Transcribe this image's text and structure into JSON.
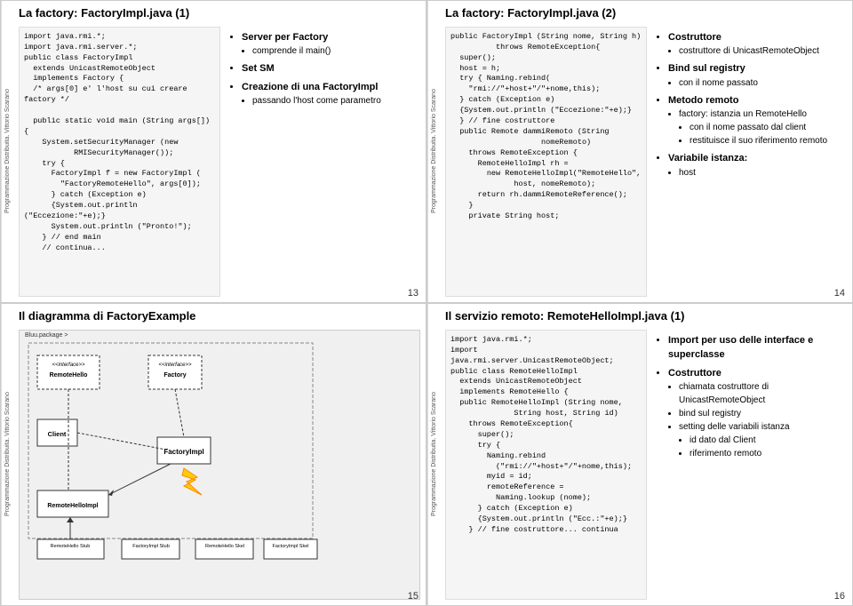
{
  "slides": [
    {
      "id": "slide-13",
      "title": "La factory:  FactoryImpl.java (1)",
      "side_label": "Programmazione Distribuita. Vittorio Scarano",
      "slide_num": "13",
      "code": "import java.rmi.*;\nimport java.rmi.server.*;\npublic class FactoryImpl\n  extends UnicastRemoteObject\n  implements Factory {\n  /* args[0] e' l'host su cui creare factory */\n\n  public static void main (String args[]) {\n    System.setSecurityManager (new\n           RMISecurityManager());\n    try {\n      FactoryImpl f = new FactoryImpl (\n        \"FactoryRemoteHello\", args[0]);\n      } catch (Exception e)\n      {System.out.println (\"Eccezione:\"+e);}\n      System.out.println (\"Pronto!\");\n    } // end main\n    // continua...",
      "bullets": [
        {
          "text": "Server per Factory",
          "level": 0,
          "bold": true
        },
        {
          "text": "comprende il main()",
          "level": 1,
          "bold": false
        },
        {
          "text": "Set SM",
          "level": 0,
          "bold": true
        },
        {
          "text": "Creazione di una FactoryImpl",
          "level": 0,
          "bold": true
        },
        {
          "text": "passando l'host come parametro",
          "level": 1,
          "bold": false
        }
      ]
    },
    {
      "id": "slide-14",
      "title": "La factory:  FactoryImpl.java (2)",
      "side_label": "Programmazione Distribuita. Vittorio Scarano",
      "slide_num": "14",
      "code": "public FactoryImpl (String nome, String h)\n          throws RemoteException{\n  super();\n  host = h;\n  try { Naming.rebind(\n    \"rmi://\"+host+\"/\"+nome,this);\n  } catch (Exception e)\n  {System.out.println (\"Eccezione:\"+e);}\n  } // fine costruttore\n  public Remote dammiRemoto (String\n                    nomeRemoto)\n    throws RemoteException {\n      RemoteHelloImpl rh =\n        new RemoteHelloImpl(\"RemoteHello\",\n              host, nomeRemoto);\n      return rh.dammiRemoteReference();\n    }\n    private String host;",
      "bullets": [
        {
          "text": "Costruttore",
          "level": 0,
          "bold": true
        },
        {
          "text": "costruttore di UnicastRemoteObject",
          "level": 1,
          "bold": false
        },
        {
          "text": "Bind sul registry",
          "level": 0,
          "bold": true
        },
        {
          "text": "con il nome passato",
          "level": 1,
          "bold": false
        },
        {
          "text": "Metodo remoto",
          "level": 0,
          "bold": true
        },
        {
          "text": "factory: istanzia un RemoteHello",
          "level": 1,
          "bold": false
        },
        {
          "text": "con il nome passato dal client",
          "level": 2,
          "bold": false
        },
        {
          "text": "restituisce il suo riferimento remoto",
          "level": 2,
          "bold": false
        },
        {
          "text": "Variabile istanza:",
          "level": 0,
          "bold": true
        },
        {
          "text": "host",
          "level": 1,
          "bold": false
        }
      ]
    },
    {
      "id": "slide-15",
      "title": "Il diagramma di FactoryExample",
      "side_label": "Programmazione Distribuita. Vittorio Scarano",
      "slide_num": "15"
    },
    {
      "id": "slide-16",
      "title": "Il servizio remoto: RemoteHelloImpl.java (1)",
      "side_label": "Programmazione Distribuita. Vittorio Scarano",
      "slide_num": "16",
      "code": "import java.rmi.*;\nimport java.rmi.server.UnicastRemoteObject;\npublic class RemoteHelloImpl\n  extends UnicastRemoteObject\n  implements RemoteHello {\n  public RemoteHelloImpl (String nome,\n              String host, String id)\n    throws RemoteException{\n      super();\n      try {\n        Naming.rebind\n          (\"rmi://\"+host+\"/\"+nome,this);\n        myid = id;\n        remoteReference =\n          Naming.lookup (nome);\n      } catch (Exception e)\n      {System.out.println (\"Ecc.:\"+e);}\n    } // fine costruttore... continua",
      "bullets": [
        {
          "text": "Import per uso delle interface e superclasse",
          "level": 0,
          "bold": true
        },
        {
          "text": "Costruttore",
          "level": 0,
          "bold": true
        },
        {
          "text": "chiamata costruttore di UnicastRemoteObject",
          "level": 1,
          "bold": false
        },
        {
          "text": "bind sul registry",
          "level": 1,
          "bold": false
        },
        {
          "text": "setting delle variabili istanza",
          "level": 1,
          "bold": false
        },
        {
          "text": "id dato dal Client",
          "level": 2,
          "bold": false
        },
        {
          "text": "riferimento remoto",
          "level": 2,
          "bold": false
        }
      ]
    }
  ]
}
